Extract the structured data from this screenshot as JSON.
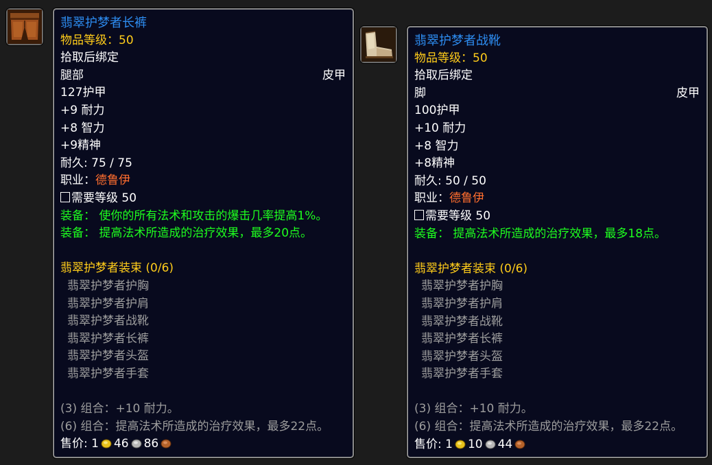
{
  "items": [
    {
      "name": "翡翠护梦者长裤",
      "item_level_label": "物品等级：",
      "item_level": "50",
      "bind": "拾取后绑定",
      "slot": "腿部",
      "armor_type": "皮甲",
      "armor": "127护甲",
      "stat1": "+9 耐力",
      "stat2": "+8 智力",
      "stat3": "+9精神",
      "durability": "耐久: 75 / 75",
      "class_label": "职业：",
      "class_name": "德鲁伊",
      "req_level": "需要等级 50",
      "equip1": "装备： 使你的所有法术和攻击的爆击几率提高1%。",
      "equip2": "装备： 提高法术所造成的治疗效果，最多20点。",
      "set_name": "翡翠护梦者装束 (0/6)",
      "set_pieces": [
        "翡翠护梦者护胸",
        "翡翠护梦者护肩",
        "翡翠护梦者战靴",
        "翡翠护梦者长裤",
        "翡翠护梦者头盔",
        "翡翠护梦者手套"
      ],
      "bonus1": "(3) 组合：+10 耐力。",
      "bonus2": "(6) 组合：提高法术所造成的治疗效果，最多22点。",
      "sell_label": "售价:",
      "sell_gold": "1",
      "sell_silver": "46",
      "sell_copper": "86",
      "icon": "leather-pants-icon"
    },
    {
      "name": "翡翠护梦者战靴",
      "item_level_label": "物品等级：",
      "item_level": "50",
      "bind": "拾取后绑定",
      "slot": "脚",
      "armor_type": "皮甲",
      "armor": "100护甲",
      "stat1": "+10 耐力",
      "stat2": "+8 智力",
      "stat3": "+8精神",
      "durability": "耐久: 50 / 50",
      "class_label": "职业：",
      "class_name": "德鲁伊",
      "req_level": "需要等级 50",
      "equip1": "装备： 提高法术所造成的治疗效果，最多18点。",
      "set_name": "翡翠护梦者装束 (0/6)",
      "set_pieces": [
        "翡翠护梦者护胸",
        "翡翠护梦者护肩",
        "翡翠护梦者战靴",
        "翡翠护梦者长裤",
        "翡翠护梦者头盔",
        "翡翠护梦者手套"
      ],
      "bonus1": "(3) 组合：+10 耐力。",
      "bonus2": "(6) 组合：提高法术所造成的治疗效果，最多22点。",
      "sell_label": "售价:",
      "sell_gold": "1",
      "sell_silver": "10",
      "sell_copper": "44",
      "icon": "leather-boots-icon"
    }
  ],
  "colors": {
    "item_name": "#2d8cf0",
    "gold_text": "#ffcc1a",
    "class_text": "#ff6d2e",
    "equip_text": "#1eff1e",
    "inactive_text": "#9d9d9d",
    "tooltip_bg": "#080a1e"
  }
}
